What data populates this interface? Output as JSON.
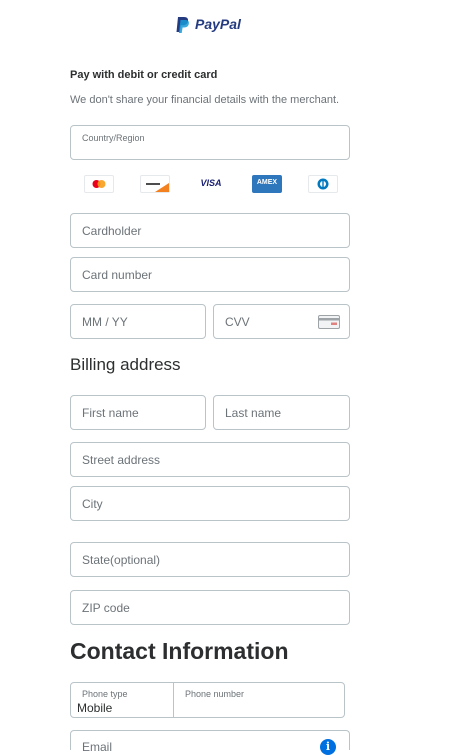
{
  "header": {
    "logo_text": "PayPal"
  },
  "form": {
    "title": "Pay with debit or credit card",
    "subtitle": "We don't share your financial details with the merchant.",
    "country_label": "Country/Region",
    "card_brands": [
      "Mastercard",
      "Discover",
      "VISA",
      "AMEX",
      "Diners Club"
    ],
    "amex_text": "AMEX",
    "visa_text": "VISA",
    "cardholder_placeholder": "Cardholder",
    "card_number_placeholder": "Card number",
    "expiry_placeholder": "MM / YY",
    "cvv_placeholder": "CVV"
  },
  "billing": {
    "heading": "Billing address",
    "first_name_placeholder": "First name",
    "last_name_placeholder": "Last name",
    "street_placeholder": "Street address",
    "city_placeholder": "City",
    "state_placeholder": "State(optional)",
    "zip_placeholder": "ZIP code"
  },
  "contact": {
    "heading": "Contact Information",
    "phone_type_label": "Phone type",
    "phone_type_value": "Mobile",
    "phone_number_label": "Phone number",
    "email_placeholder": "Email",
    "info_icon_glyph": "i"
  },
  "colors": {
    "paypal_dark": "#253b80",
    "paypal_light": "#179bd7",
    "info_icon": "#0070e0",
    "border": "#b9c4c9"
  }
}
